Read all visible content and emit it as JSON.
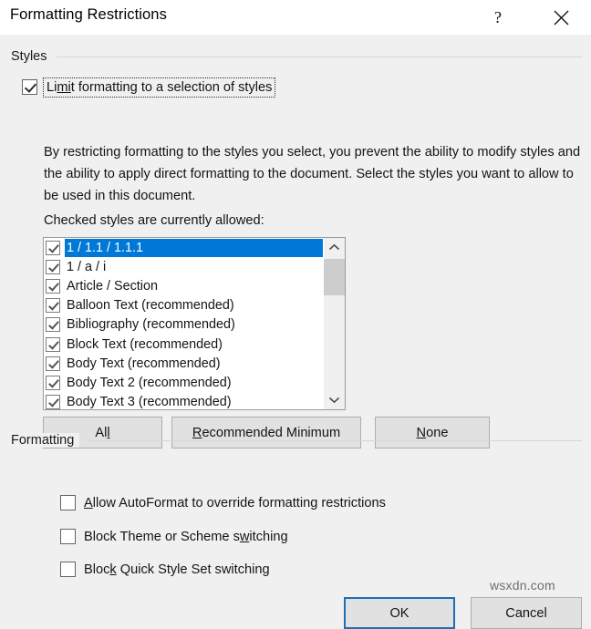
{
  "window": {
    "title": "Formatting Restrictions",
    "help_label": "?",
    "close_label": "✕"
  },
  "styles_group": {
    "label": "Styles",
    "limit_checkbox": {
      "checked": true,
      "text_before": "Li",
      "accel": "mi",
      "text_after": "t formatting to a selection of styles"
    },
    "description": "By restricting formatting to the styles you select, you prevent the ability to modify styles and the ability to apply direct formatting to the document. Select the styles you want to allow to be used in this document.",
    "list_caption": "Checked styles are currently allowed:",
    "list_items": [
      {
        "label": "1 / 1.1 / 1.1.1",
        "checked": true,
        "selected": true
      },
      {
        "label": "1 / a / i",
        "checked": true,
        "selected": false
      },
      {
        "label": "Article / Section",
        "checked": true,
        "selected": false
      },
      {
        "label": "Balloon Text (recommended)",
        "checked": true,
        "selected": false
      },
      {
        "label": "Bibliography (recommended)",
        "checked": true,
        "selected": false
      },
      {
        "label": "Block Text (recommended)",
        "checked": true,
        "selected": false
      },
      {
        "label": "Body Text (recommended)",
        "checked": true,
        "selected": false
      },
      {
        "label": "Body Text 2 (recommended)",
        "checked": true,
        "selected": false
      },
      {
        "label": "Body Text 3 (recommended)",
        "checked": true,
        "selected": false
      }
    ],
    "buttons": {
      "all": {
        "before": "Al",
        "accel": "l",
        "after": ""
      },
      "recommended_minimum": {
        "before": "",
        "accel": "R",
        "after": "ecommended Minimum"
      },
      "none": {
        "before": "",
        "accel": "N",
        "after": "one"
      }
    }
  },
  "formatting_group": {
    "label": "Formatting",
    "checkboxes": [
      {
        "before": "",
        "accel": "A",
        "after": "llow AutoFormat to override formatting restrictions",
        "checked": false
      },
      {
        "before": "Block Theme or Scheme s",
        "accel": "w",
        "after": "itching",
        "checked": false
      },
      {
        "before": "Bloc",
        "accel": "k",
        "after": " Quick Style Set switching",
        "checked": false
      }
    ]
  },
  "footer": {
    "ok_label": "OK",
    "cancel_label": "Cancel"
  },
  "watermark": "wsxdn.com",
  "colors": {
    "accent": "#0078d7",
    "default_button_border": "#1f6fb2",
    "dialog_background": "#f0f0f0",
    "titlebar_background": "#ffffff",
    "scrollbar_thumb": "#cdcdcd"
  }
}
